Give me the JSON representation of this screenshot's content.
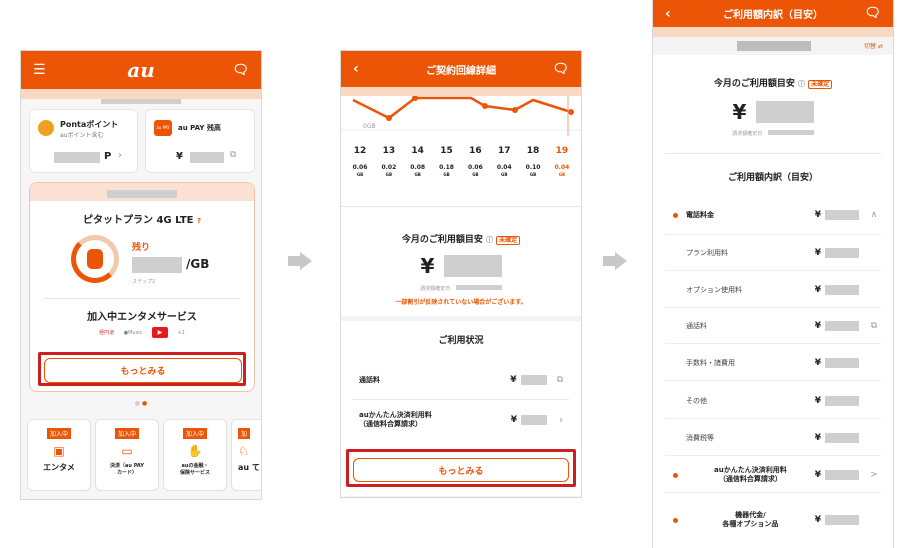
{
  "phone1": {
    "logo": "au",
    "ponta_title": "Pontaポイント",
    "ponta_sub": "auポイント含む",
    "ponta_unit": "P",
    "aupay_icon": "au PAY",
    "aupay_title": "au PAY 残高",
    "aupay_unit": "¥",
    "plan_name": "ピタットプラン 4G LTE",
    "remain_label": "残り",
    "gb_unit": "/GB",
    "step": "ステップ2",
    "ent_title": "加入中エンタメサービス",
    "ent_icons": [
      "極円道",
      "●Music",
      "+1"
    ],
    "more_button": "もっとみる",
    "services": [
      {
        "tag": "加入中",
        "label": "エンタメ"
      },
      {
        "tag": "加入中",
        "label": "決済（au PAY\nカード）"
      },
      {
        "tag": "加入中",
        "label": "auの金融・\n保険サービス"
      },
      {
        "tag": "加",
        "label": "au て"
      }
    ]
  },
  "phone2": {
    "title": "ご契約回線詳細",
    "gauge_label": "0GB",
    "days": [
      "12",
      "13",
      "14",
      "15",
      "16",
      "17",
      "18",
      "19"
    ],
    "values": [
      "0.06",
      "0.02",
      "0.08",
      "0.18",
      "0.06",
      "0.04",
      "0.10",
      "0.04"
    ],
    "unit": "GB",
    "estimate_title": "今月のご利用額目安",
    "badge": "未確定",
    "yen": "¥",
    "confirm_label": "請求額確定日",
    "warning": "一部割引が反映されていない場合がございます。",
    "status_title": "ご利用状況",
    "call_label": "通話料",
    "easy_pay_label": "auかんたん決済利用料\n（通信料合算請求）",
    "yen_small": "¥",
    "more_button": "もっとみる"
  },
  "phone3": {
    "title": "ご利用額内訳（目安）",
    "switch": "切替",
    "estimate_title": "今月のご利用額目安",
    "badge": "未確定",
    "yen": "¥",
    "confirm_label": "請求額確定日",
    "breakdown_title": "ご利用額内訳（目安）",
    "items": [
      {
        "label": "電話料金",
        "dot": true,
        "suffix": "∧"
      },
      {
        "label": "プラン利用料",
        "dot": false,
        "suffix": ""
      },
      {
        "label": "オプション使用料",
        "dot": false,
        "suffix": ""
      },
      {
        "label": "通話料",
        "dot": false,
        "suffix": "⧉"
      },
      {
        "label": "手数料・諸費用",
        "dot": false,
        "suffix": ""
      },
      {
        "label": "その他",
        "dot": false,
        "suffix": ""
      },
      {
        "label": "消費税等",
        "dot": false,
        "suffix": ""
      },
      {
        "label": "auかんたん決済利用料\n（通信料合算請求）",
        "dot": true,
        "suffix": ">"
      },
      {
        "label": "機器代金/\n各種オプション品",
        "dot": true,
        "suffix": ""
      }
    ],
    "yen_small": "¥"
  }
}
